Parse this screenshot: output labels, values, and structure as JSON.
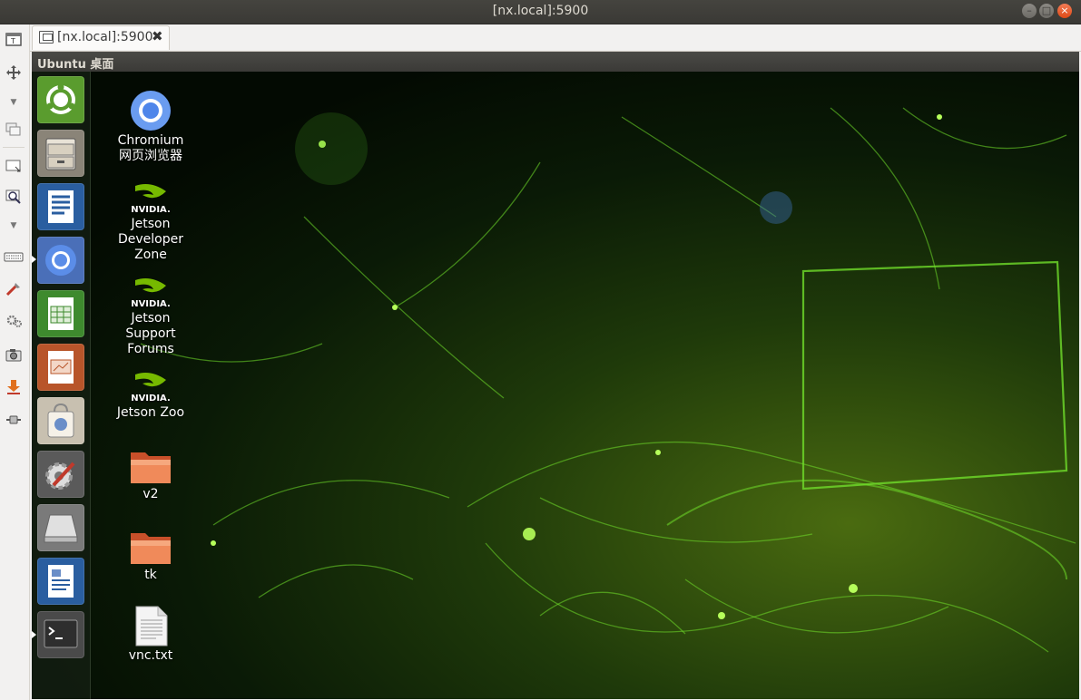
{
  "window": {
    "title": "[nx.local]:5900",
    "buttons": {
      "minimize": "–",
      "maximize": "□",
      "close": "×"
    }
  },
  "toolbar": {
    "icons": [
      "screenshot-icon",
      "fullscreen-icon",
      "dropdown-icon",
      "windows-icon",
      "resize-icon",
      "zoom-icon",
      "dropdown-icon",
      "keyboard-icon",
      "tools-icon",
      "settings-icon",
      "camera-icon",
      "download-icon",
      "plug-icon"
    ]
  },
  "tabs": [
    {
      "label": "[nx.local]:5900",
      "close": "✖"
    }
  ],
  "remote": {
    "panel_title": "Ubuntu 桌面",
    "launcher": [
      {
        "name": "ubuntu-dash",
        "color": "#5a9c2e"
      },
      {
        "name": "files",
        "color": "#8a8478"
      },
      {
        "name": "libreoffice-writer",
        "color": "#2a5ea0"
      },
      {
        "name": "chromium",
        "color": "#4a6fb8"
      },
      {
        "name": "libreoffice-calc",
        "color": "#3e8a2e"
      },
      {
        "name": "libreoffice-impress",
        "color": "#b8552a"
      },
      {
        "name": "software-center",
        "color": "#c8c0b0"
      },
      {
        "name": "system-settings",
        "color": "#5a5a5a"
      },
      {
        "name": "drive",
        "color": "#7a7a7a"
      },
      {
        "name": "document-viewer",
        "color": "#2a5ea0"
      },
      {
        "name": "terminal",
        "color": "#4a4a4a"
      }
    ],
    "desktop_icons": [
      {
        "label": "Chromium\n网页浏览器",
        "type": "chromium"
      },
      {
        "label": "Jetson\nDeveloper\nZone",
        "type": "nvidia"
      },
      {
        "label": "Jetson\nSupport\nForums",
        "type": "nvidia"
      },
      {
        "label": "Jetson Zoo",
        "type": "nvidia"
      },
      {
        "label": "v2",
        "type": "folder"
      },
      {
        "label": "tk",
        "type": "folder"
      },
      {
        "label": "vnc.txt",
        "type": "text"
      }
    ],
    "nvidia_wordmark": "NVIDIA."
  },
  "colors": {
    "titlebar": "#3c3b37",
    "close_button": "#df4a16",
    "nvidia_green": "#76b900",
    "folder": "#e8683a"
  }
}
